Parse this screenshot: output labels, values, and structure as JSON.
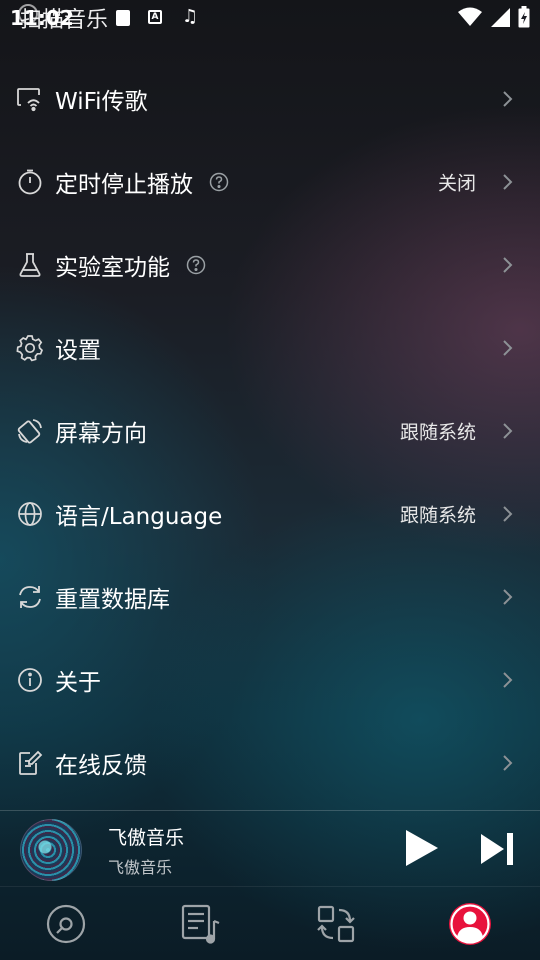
{
  "status_bar": {
    "time": "11:02",
    "notification_text": "扫描音乐",
    "notif_badge": "A",
    "music_note": "♫"
  },
  "menu": {
    "items": [
      {
        "label": "WiFi传歌",
        "icon": "wifi-transfer-icon",
        "value": ""
      },
      {
        "label": "定时停止播放",
        "icon": "timer-icon",
        "value": "关闭",
        "help": true
      },
      {
        "label": "实验室功能",
        "icon": "flask-icon",
        "value": "",
        "help": true
      },
      {
        "label": "设置",
        "icon": "gear-icon",
        "value": ""
      },
      {
        "label": "屏幕方向",
        "icon": "rotate-screen-icon",
        "value": "跟随系统"
      },
      {
        "label": "语言/Language",
        "icon": "globe-icon",
        "value": "跟随系统"
      },
      {
        "label": "重置数据库",
        "icon": "refresh-icon",
        "value": ""
      },
      {
        "label": "关于",
        "icon": "info-icon",
        "value": ""
      },
      {
        "label": "在线反馈",
        "icon": "feedback-edit-icon",
        "value": ""
      }
    ]
  },
  "player": {
    "title": "飞傲音乐",
    "artist": "飞傲音乐"
  },
  "bottom_nav": {
    "items": [
      "disc-icon",
      "playlist-icon",
      "switch-icon",
      "profile-icon"
    ],
    "active": "profile-icon"
  },
  "colors": {
    "accent": "#e8123c",
    "text": "#ffffff",
    "secondary_text": "#bfc4c8"
  }
}
